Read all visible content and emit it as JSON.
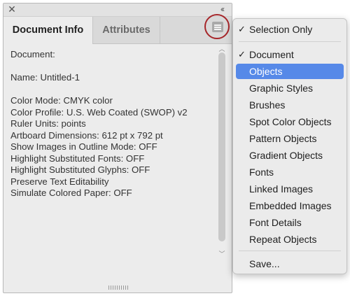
{
  "panel": {
    "close_glyph": "✕",
    "collapse_glyph": "‹‹",
    "tabs": [
      {
        "label": "Document Info",
        "active": true
      },
      {
        "label": "Attributes",
        "active": false
      }
    ],
    "menu_button_icon": "hamburger-menu-icon",
    "info_lines": [
      "Document:",
      "",
      "Name: Untitled-1",
      "",
      "Color Mode: CMYK color",
      "Color Profile: U.S. Web Coated (SWOP) v2",
      "Ruler Units: points",
      "Artboard Dimensions: 612 pt x 792 pt",
      "Show Images in Outline Mode: OFF",
      "Highlight Substituted Fonts: OFF",
      "Highlight Substituted Glyphs: OFF",
      "Preserve Text Editability",
      "Simulate Colored Paper: OFF"
    ]
  },
  "flyout_menu": {
    "check_glyph": "✓",
    "groups": [
      [
        {
          "label": "Selection Only",
          "checked": true
        }
      ],
      [
        {
          "label": "Document",
          "checked": true
        },
        {
          "label": "Objects",
          "highlighted": true
        },
        {
          "label": "Graphic Styles"
        },
        {
          "label": "Brushes"
        },
        {
          "label": "Spot Color Objects"
        },
        {
          "label": "Pattern Objects"
        },
        {
          "label": "Gradient Objects"
        },
        {
          "label": "Fonts"
        },
        {
          "label": "Linked Images"
        },
        {
          "label": "Embedded Images"
        },
        {
          "label": "Font Details"
        },
        {
          "label": "Repeat Objects"
        }
      ],
      [
        {
          "label": "Save..."
        }
      ]
    ]
  },
  "colors": {
    "highlight": "#5689e8",
    "annotation_ring": "#a6262a"
  }
}
